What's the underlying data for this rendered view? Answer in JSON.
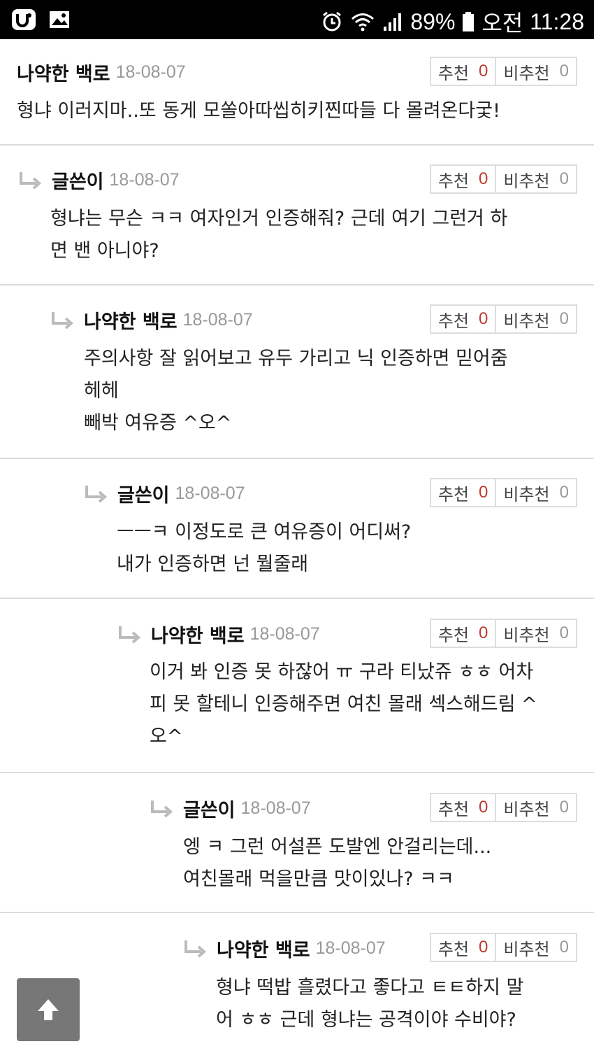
{
  "status": {
    "battery": "89%",
    "ampm": "오전",
    "time": "11:28"
  },
  "votes": {
    "up_label": "추천",
    "down_label": "비추천"
  },
  "comments": [
    {
      "author": "나약한 백로",
      "date": "18-08-07",
      "up": "0",
      "down": "0",
      "lines": [
        "형냐 이러지마..또 동게 모쏠아따씹히키찐따들 다 몰려온다궃!"
      ]
    },
    {
      "author": "글쓴이",
      "date": "18-08-07",
      "up": "0",
      "down": "0",
      "lines": [
        "형냐는 무슨 ㅋㅋ 여자인거 인증해줘? 근데 여기 그런거 하",
        "면 밴 아니야?"
      ]
    },
    {
      "author": "나약한 백로",
      "date": "18-08-07",
      "up": "0",
      "down": "0",
      "lines": [
        "주의사항 잘 읽어보고 유두 가리고 닉 인증하면 믿어줌",
        "헤헤",
        "빼박 여유증 ^오^"
      ]
    },
    {
      "author": "글쓴이",
      "date": "18-08-07",
      "up": "0",
      "down": "0",
      "lines": [
        "ㅡㅡㅋ 이정도로 큰 여유증이 어디써?",
        "내가 인증하면 넌 뭘줄래"
      ]
    },
    {
      "author": "나약한 백로",
      "date": "18-08-07",
      "up": "0",
      "down": "0",
      "lines": [
        "이거 봐 인증 못 하잖어 ㅠ 구라 티났쥬 ㅎㅎ 어차",
        "피 못 할테니 인증해주면 여친 몰래 섹스해드림 ^",
        "오^"
      ]
    },
    {
      "author": "글쓴이",
      "date": "18-08-07",
      "up": "0",
      "down": "0",
      "lines": [
        "엥 ㅋ 그런 어설픈 도발엔 안걸리는데...",
        "여친몰래 먹을만큼 맛이있나? ㅋㅋ"
      ]
    },
    {
      "author": "나약한 백로",
      "date": "18-08-07",
      "up": "0",
      "down": "0",
      "lines": [
        "형냐 떡밥 흘렸다고 좋다고 ㅌㅌ하지 말",
        "어 ㅎㅎ 근데 형냐는 공격이야 수비야?"
      ]
    }
  ]
}
